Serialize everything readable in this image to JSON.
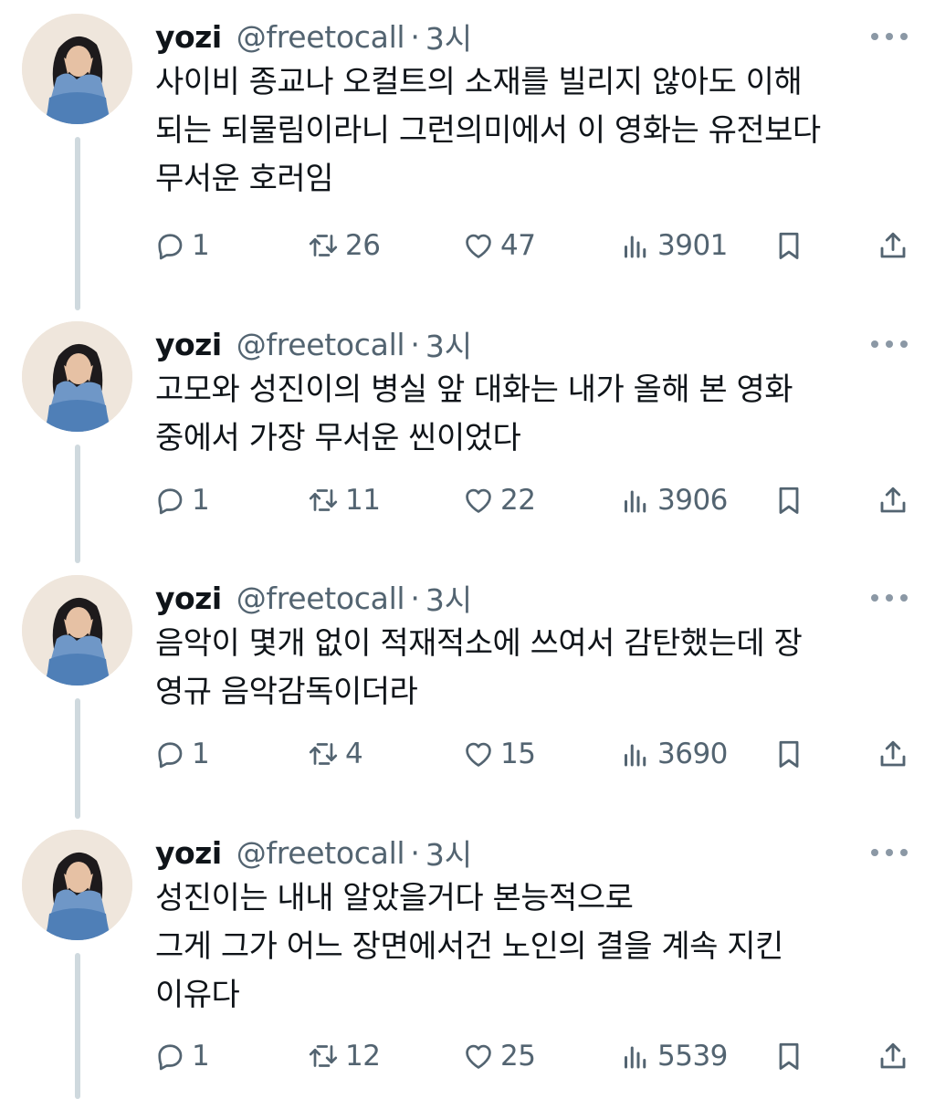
{
  "tweets": [
    {
      "name": "yozi",
      "handle": "@freetocall",
      "separator": "·",
      "time": "3시",
      "lines": [
        "사이비 종교나 오컬트의 소재를 빌리지 않아도 이해",
        "되는 되물림이라니 그런의미에서 이 영화는 유전보다",
        "무서운 호러임"
      ],
      "replies": "1",
      "retweets": "26",
      "likes": "47",
      "views": "3901"
    },
    {
      "name": "yozi",
      "handle": "@freetocall",
      "separator": "·",
      "time": "3시",
      "lines": [
        "고모와 성진이의 병실 앞 대화는 내가 올해 본 영화",
        "중에서 가장 무서운 씬이었다"
      ],
      "replies": "1",
      "retweets": "11",
      "likes": "22",
      "views": "3906"
    },
    {
      "name": "yozi",
      "handle": "@freetocall",
      "separator": "·",
      "time": "3시",
      "lines": [
        "음악이 몇개 없이 적재적소에 쓰여서 감탄했는데 장",
        "영규 음악감독이더라"
      ],
      "replies": "1",
      "retweets": "4",
      "likes": "15",
      "views": "3690"
    },
    {
      "name": "yozi",
      "handle": "@freetocall",
      "separator": "·",
      "time": "3시",
      "lines": [
        "성진이는 내내 알았을거다 본능적으로",
        "그게 그가 어느 장면에서건 노인의 결을 계속 지킨",
        "이유다"
      ],
      "replies": "1",
      "retweets": "12",
      "likes": "25",
      "views": "5539"
    }
  ],
  "colors": {
    "text": "#0f1419",
    "secondary": "#536471",
    "thread_line": "#cfd9de"
  },
  "icons": [
    "more-icon",
    "reply-icon",
    "retweet-icon",
    "like-icon",
    "views-icon",
    "bookmark-icon",
    "share-icon"
  ]
}
